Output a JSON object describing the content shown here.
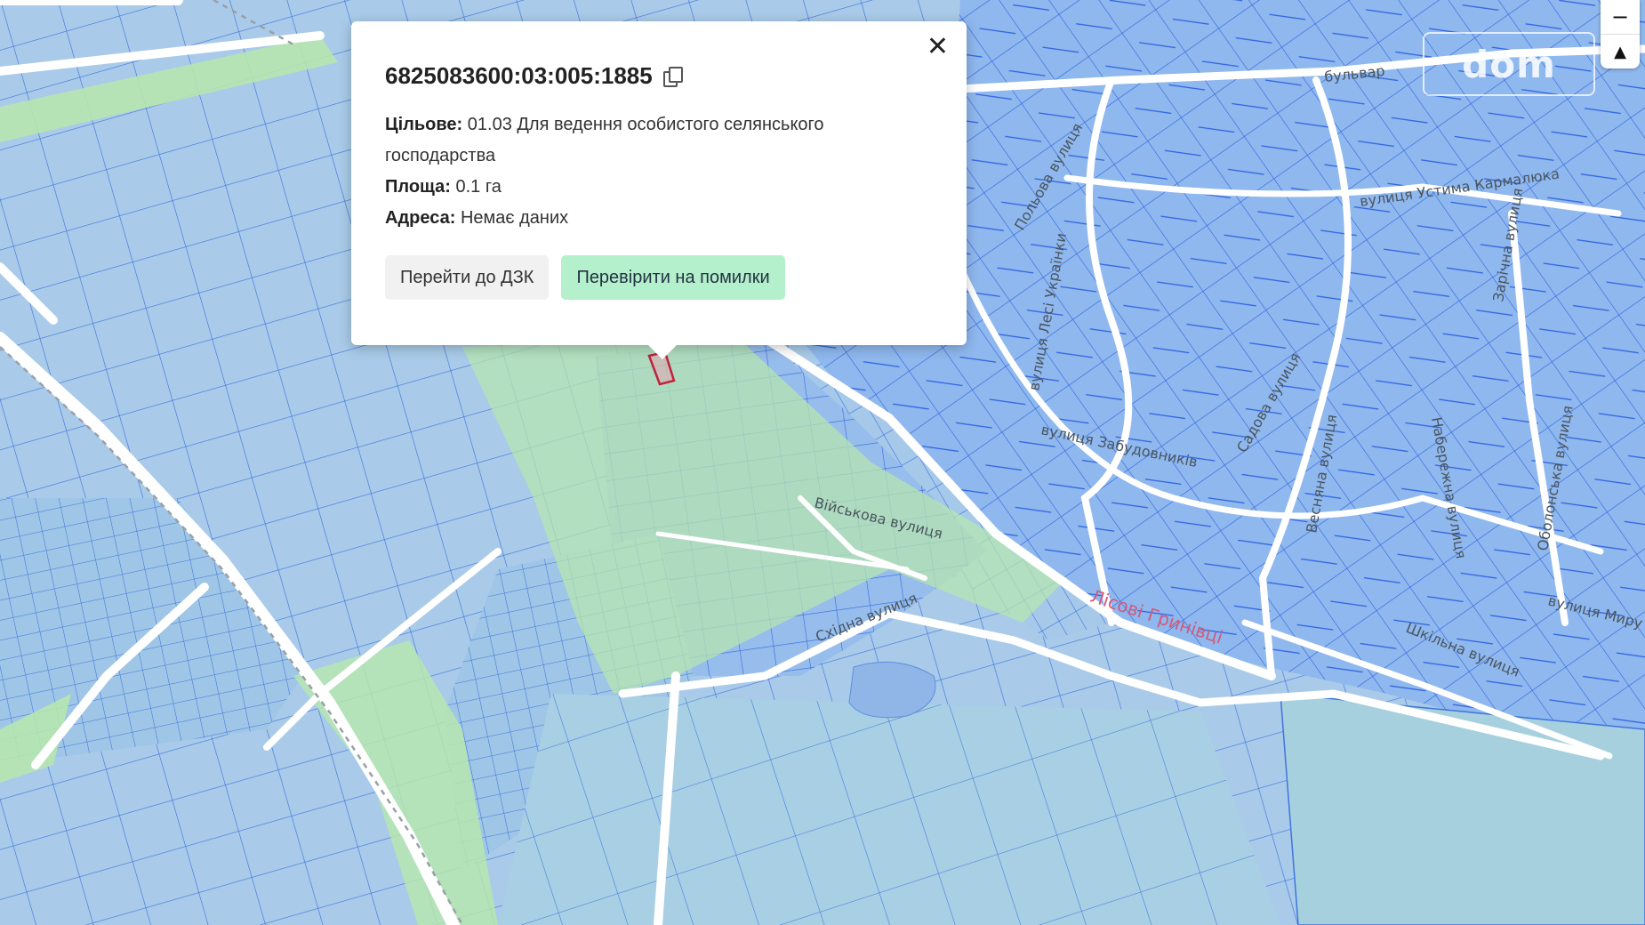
{
  "popup": {
    "cadastral_number": "6825083600:03:005:1885",
    "fields": [
      {
        "label": "Цільове:",
        "value": "01.03 Для ведення особистого селянського господарства"
      },
      {
        "label": "Площа:",
        "value": "0.1 га"
      },
      {
        "label": "Адреса:",
        "value": "Немає даних"
      }
    ],
    "close_glyph": "✕",
    "buttons": {
      "go_dzk": "Перейти до ДЗК",
      "check_errors": "Перевірити на помилки"
    }
  },
  "map": {
    "street_labels": [
      "бульвар",
      "Зарічна вулиця",
      "вулиця Устима Кармалюка",
      "вулиця Лесі Українки",
      "вулиця Забудовників",
      "Садова вулиця",
      "Весняна вулиця",
      "Набережна вулиця",
      "Оболонська вулиця",
      "Військова вулиця",
      "Східна вулиця",
      "Лісові Гринівці",
      "вулиця Миру",
      "Польова вулиця",
      "Шкільна вулиця"
    ]
  },
  "watermark": "dom",
  "zoom": {
    "out": "−",
    "north": "▲"
  },
  "colors": {
    "parcel_fill": "#9ec3ef",
    "parcel_stroke": "#3a6fe0",
    "road": "#ffffff",
    "green": "#b6e6b0",
    "selected": "#c0233c"
  }
}
